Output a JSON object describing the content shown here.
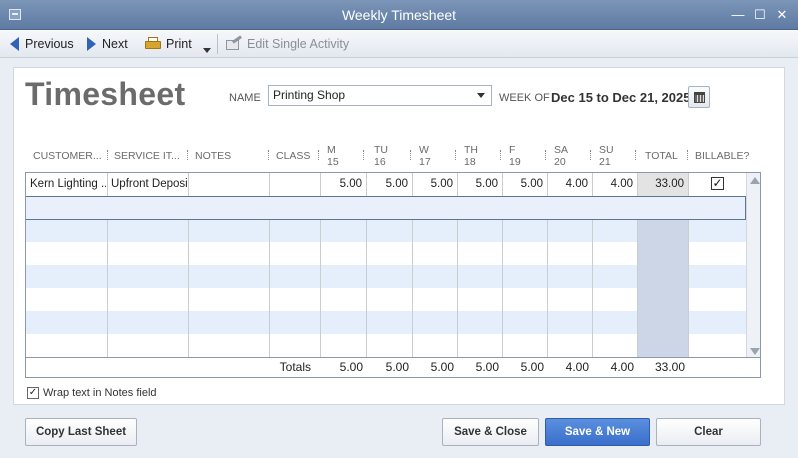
{
  "window": {
    "title": "Weekly Timesheet",
    "min": "—",
    "max": "☐",
    "close": "✕"
  },
  "toolbar": {
    "previous": "Previous",
    "next": "Next",
    "print": "Print",
    "edit_single": "Edit Single Activity"
  },
  "form": {
    "heading": "Timesheet",
    "name_label": "NAME",
    "name_value": "Printing Shop",
    "week_of_label": "WEEK OF",
    "week_of_value": "Dec 15 to Dec 21, 2025"
  },
  "columns": {
    "customer": "CUSTOMER...",
    "service": "SERVICE IT...",
    "notes": "NOTES",
    "class": "CLASS",
    "days": [
      {
        "d": "M",
        "n": "15"
      },
      {
        "d": "TU",
        "n": "16"
      },
      {
        "d": "W",
        "n": "17"
      },
      {
        "d": "TH",
        "n": "18"
      },
      {
        "d": "F",
        "n": "19"
      },
      {
        "d": "SA",
        "n": "20"
      },
      {
        "d": "SU",
        "n": "21"
      }
    ],
    "total": "TOTAL",
    "billable": "BILLABLE?"
  },
  "rows": [
    {
      "customer": "Kern Lighting ...",
      "service": "Upfront Deposit",
      "notes": "",
      "class": "",
      "hours": [
        "5.00",
        "5.00",
        "5.00",
        "5.00",
        "5.00",
        "4.00",
        "4.00"
      ],
      "total": "33.00",
      "billable": "✓"
    }
  ],
  "totals": {
    "label": "Totals",
    "hours": [
      "5.00",
      "5.00",
      "5.00",
      "5.00",
      "5.00",
      "4.00",
      "4.00"
    ],
    "total": "33.00"
  },
  "options": {
    "wrap_text_checked": "✓",
    "wrap_text_label": "Wrap text in Notes field"
  },
  "buttons": {
    "copy_last": "Copy Last Sheet",
    "save_close": "Save & Close",
    "save_new": "Save & New",
    "clear": "Clear"
  },
  "colors": {
    "accent": "#3a6fcc",
    "titlebar": "#6a85ad",
    "alt_row": "#e5eefb"
  }
}
